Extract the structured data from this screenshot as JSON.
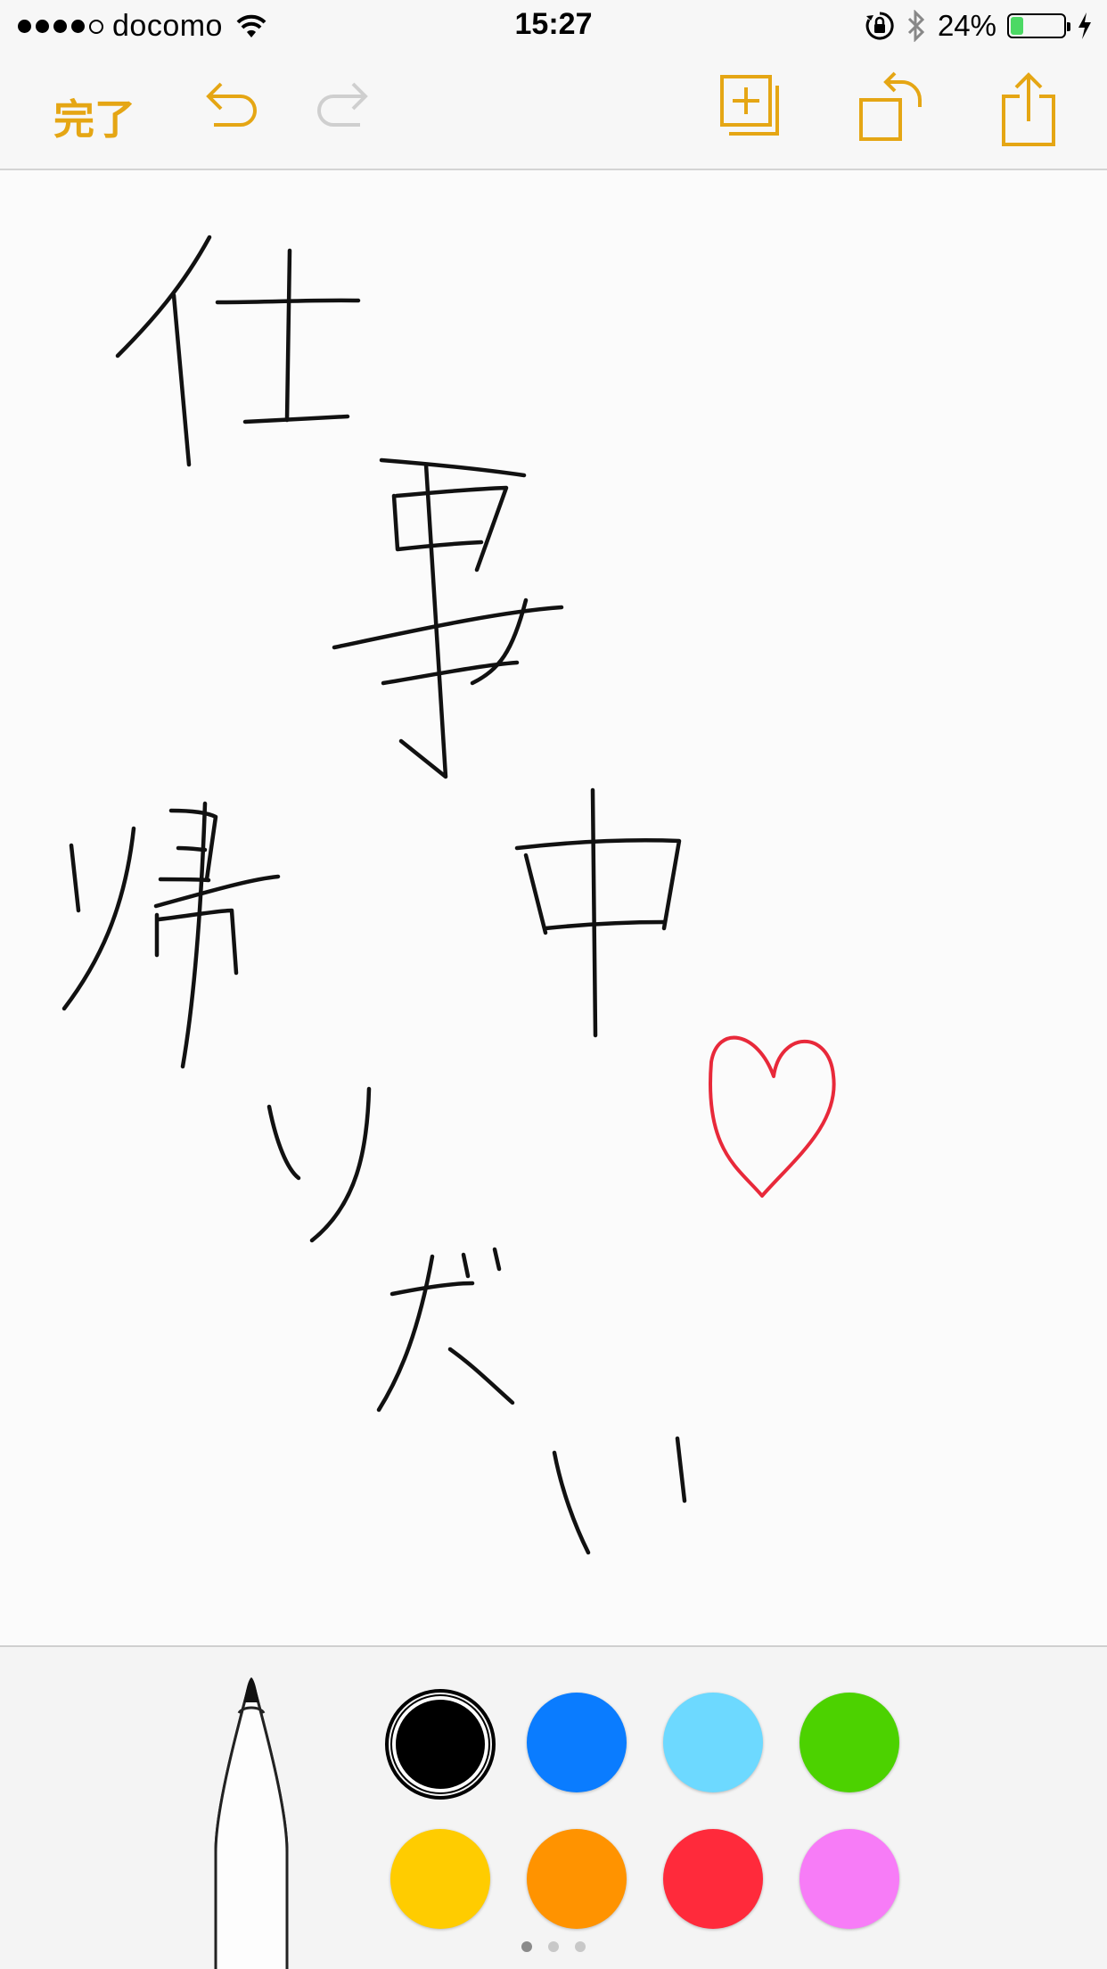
{
  "status_bar": {
    "carrier": "docomo",
    "time": "15:27",
    "battery_percent": "24%",
    "battery_level": 0.24,
    "signal_bars_filled": 4,
    "signal_bars_total": 5
  },
  "toolbar": {
    "done_label": "完了",
    "icons": [
      "undo-icon",
      "redo-icon",
      "add-page-icon",
      "rotate-icon",
      "share-icon"
    ]
  },
  "palette": {
    "selected": "black",
    "colors": [
      {
        "name": "black",
        "hex": "#000000"
      },
      {
        "name": "blue",
        "hex": "#0a7cff"
      },
      {
        "name": "light-blue",
        "hex": "#6dd9ff"
      },
      {
        "name": "green",
        "hex": "#4cd200"
      },
      {
        "name": "yellow",
        "hex": "#ffcc00"
      },
      {
        "name": "orange",
        "hex": "#ff9300"
      },
      {
        "name": "red",
        "hex": "#ff2a3b"
      },
      {
        "name": "pink",
        "hex": "#f77cf7"
      }
    ],
    "page_count": 3,
    "active_page": 1
  },
  "colors": {
    "accent": "#e5a614",
    "ink": "#111111",
    "heart": "#e8293a"
  }
}
